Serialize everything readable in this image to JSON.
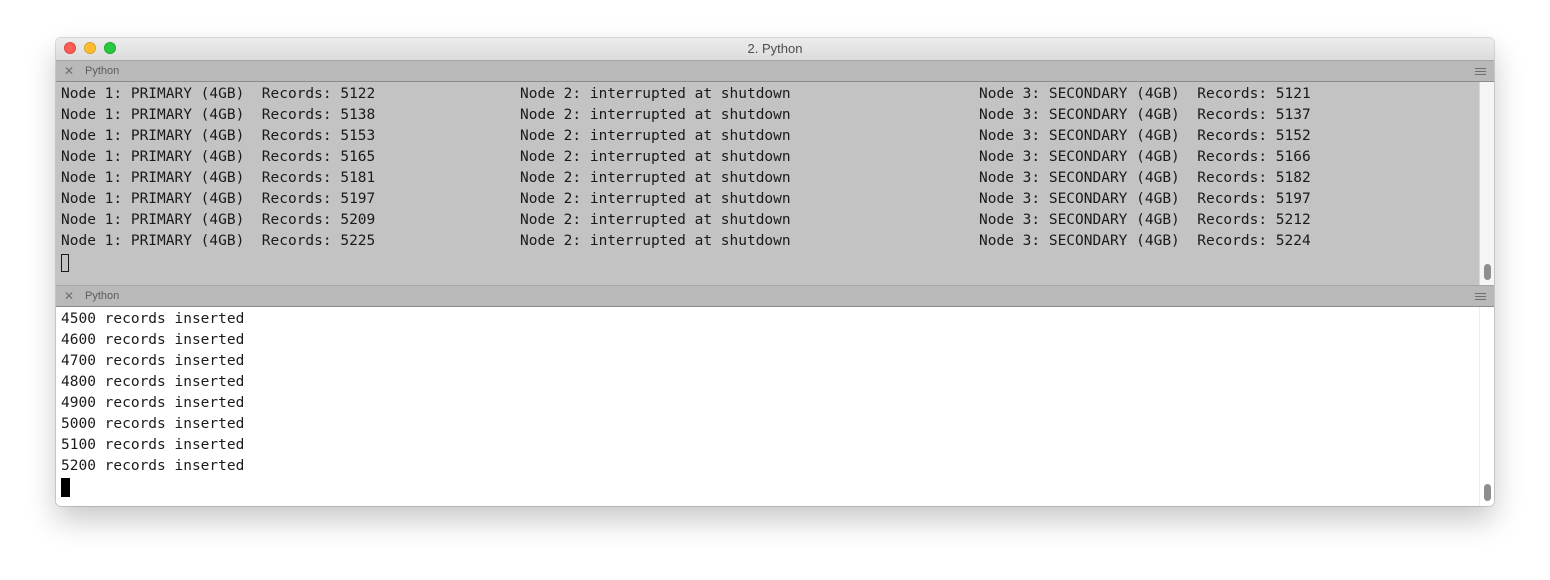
{
  "window": {
    "title": "2. Python"
  },
  "top_pane": {
    "tab_title": "Python",
    "rows": [
      {
        "col1": "Node 1: PRIMARY (4GB)  Records: 5122",
        "col2": "Node 2: interrupted at shutdown",
        "col3": "Node 3: SECONDARY (4GB)  Records: 5121"
      },
      {
        "col1": "Node 1: PRIMARY (4GB)  Records: 5138",
        "col2": "Node 2: interrupted at shutdown",
        "col3": "Node 3: SECONDARY (4GB)  Records: 5137"
      },
      {
        "col1": "Node 1: PRIMARY (4GB)  Records: 5153",
        "col2": "Node 2: interrupted at shutdown",
        "col3": "Node 3: SECONDARY (4GB)  Records: 5152"
      },
      {
        "col1": "Node 1: PRIMARY (4GB)  Records: 5165",
        "col2": "Node 2: interrupted at shutdown",
        "col3": "Node 3: SECONDARY (4GB)  Records: 5166"
      },
      {
        "col1": "Node 1: PRIMARY (4GB)  Records: 5181",
        "col2": "Node 2: interrupted at shutdown",
        "col3": "Node 3: SECONDARY (4GB)  Records: 5182"
      },
      {
        "col1": "Node 1: PRIMARY (4GB)  Records: 5197",
        "col2": "Node 2: interrupted at shutdown",
        "col3": "Node 3: SECONDARY (4GB)  Records: 5197"
      },
      {
        "col1": "Node 1: PRIMARY (4GB)  Records: 5209",
        "col2": "Node 2: interrupted at shutdown",
        "col3": "Node 3: SECONDARY (4GB)  Records: 5212"
      },
      {
        "col1": "Node 1: PRIMARY (4GB)  Records: 5225",
        "col2": "Node 2: interrupted at shutdown",
        "col3": "Node 3: SECONDARY (4GB)  Records: 5224"
      }
    ]
  },
  "bottom_pane": {
    "tab_title": "Python",
    "lines": [
      "4500 records inserted",
      "4600 records inserted",
      "4700 records inserted",
      "4800 records inserted",
      "4900 records inserted",
      "5000 records inserted",
      "5100 records inserted",
      "5200 records inserted"
    ]
  },
  "icons": {
    "pane_close": "close-icon",
    "pane_menu": "hamburger-menu-icon"
  },
  "colors": {
    "close": "#fe5f57",
    "minimize": "#febc2e",
    "zoom": "#28c840",
    "top_pane_bg": "#c3c3c3",
    "bottom_pane_bg": "#ffffff"
  }
}
